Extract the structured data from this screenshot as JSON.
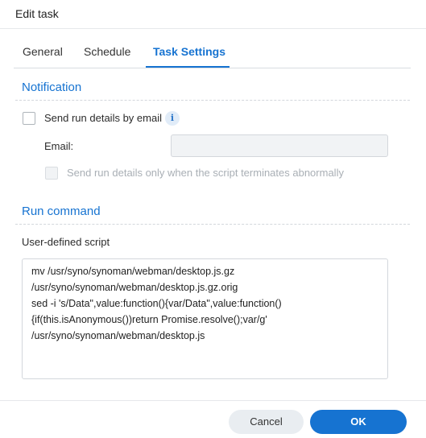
{
  "dialog": {
    "title": "Edit task"
  },
  "tabs": [
    {
      "label": "General",
      "active": false
    },
    {
      "label": "Schedule",
      "active": false
    },
    {
      "label": "Task Settings",
      "active": true
    }
  ],
  "notification": {
    "section_title": "Notification",
    "send_email_label": "Send run details by email",
    "send_email_checked": false,
    "info_icon": "info-icon",
    "email_label": "Email:",
    "email_value": "",
    "abnormal_only_label": "Send run details only when the script terminates abnormally",
    "abnormal_only_checked": false
  },
  "run_command": {
    "section_title": "Run command",
    "script_label": "User-defined script",
    "script_lines": [
      "mv /usr/syno/synoman/webman/desktop.js.gz",
      "/usr/syno/synoman/webman/desktop.js.gz.orig",
      "sed -i 's/Data\",value:function(){var/Data\",value:function()",
      "{if(this.isAnonymous())return Promise.resolve();var/g'",
      "/usr/syno/synoman/webman/desktop.js"
    ]
  },
  "footer": {
    "cancel_label": "Cancel",
    "ok_label": "OK"
  },
  "colors": {
    "accent": "#1673d1",
    "ok_button": "#1673d1",
    "cancel_button": "#e9edf1"
  }
}
